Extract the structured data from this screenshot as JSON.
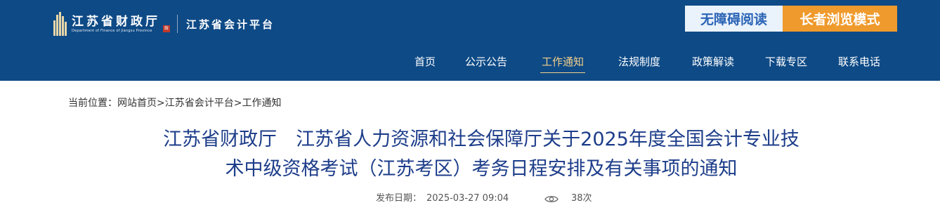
{
  "header": {
    "logo_cn": "江苏省财政厅",
    "logo_en": "Department of Finance of Jiangsu Province",
    "logo_seal": "政",
    "logo_sub": "江苏省会计平台",
    "accessibility_label": "无障碍阅读",
    "elder_mode_label": "长者浏览模式",
    "brand_color": "#0e4a86",
    "accent_color": "#ef9a2c"
  },
  "nav": {
    "items": [
      {
        "label": "首页",
        "active": false
      },
      {
        "label": "公示公告",
        "active": false
      },
      {
        "label": "工作通知",
        "active": true
      },
      {
        "label": "法规制度",
        "active": false
      },
      {
        "label": "政策解读",
        "active": false
      },
      {
        "label": "下载专区",
        "active": false
      },
      {
        "label": "联系电话",
        "active": false
      }
    ]
  },
  "breadcrumb": {
    "prefix": "当前位置：",
    "items": [
      "网站首页",
      "江苏省会计平台",
      "工作通知"
    ],
    "separator": ">"
  },
  "article": {
    "title_line1": "江苏省财政厅　江苏省人力资源和社会保障厅关于2025年度全国会计专业技",
    "title_line2": "术中级资格考试（江苏考区）考务日程安排及有关事项的通知",
    "date_label": "发布日期：",
    "date": "2025-03-27  09:04",
    "views": "38次",
    "title_color": "#1d3d8a"
  }
}
